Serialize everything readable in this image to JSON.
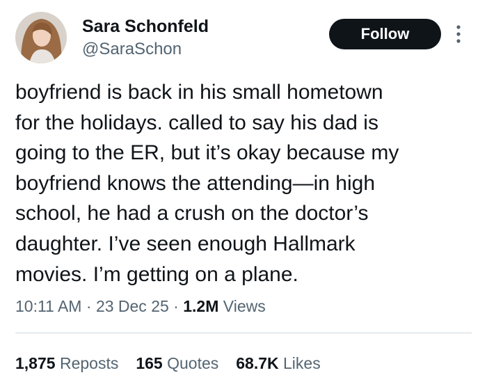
{
  "author": {
    "display_name": "Sara Schonfeld",
    "handle": "@SaraSchon"
  },
  "actions": {
    "follow_label": "Follow",
    "more_icon": "more-vertical-icon"
  },
  "tweet": {
    "text": "boyfriend is back in his small hometown\nfor the holidays. called to say his dad is\ngoing to the ER, but it’s okay because my\nboyfriend knows the attending—in high\nschool, he had a crush on the doctor’s\ndaughter. I’ve seen enough Hallmark\nmovies. I’m getting on a plane."
  },
  "meta": {
    "time": "10:11 AM",
    "sep1": " · ",
    "date": "23 Dec 25",
    "sep2": " · ",
    "views_count": "1.2M",
    "views_label": " Views"
  },
  "stats": [
    {
      "count": "1,875",
      "label": "Reposts"
    },
    {
      "count": "165",
      "label": "Quotes"
    },
    {
      "count": "68.7K",
      "label": "Likes"
    }
  ],
  "colors": {
    "text": "#0f1419",
    "secondary": "#536471",
    "button_bg": "#0f1419",
    "divider": "#cfd9de"
  }
}
